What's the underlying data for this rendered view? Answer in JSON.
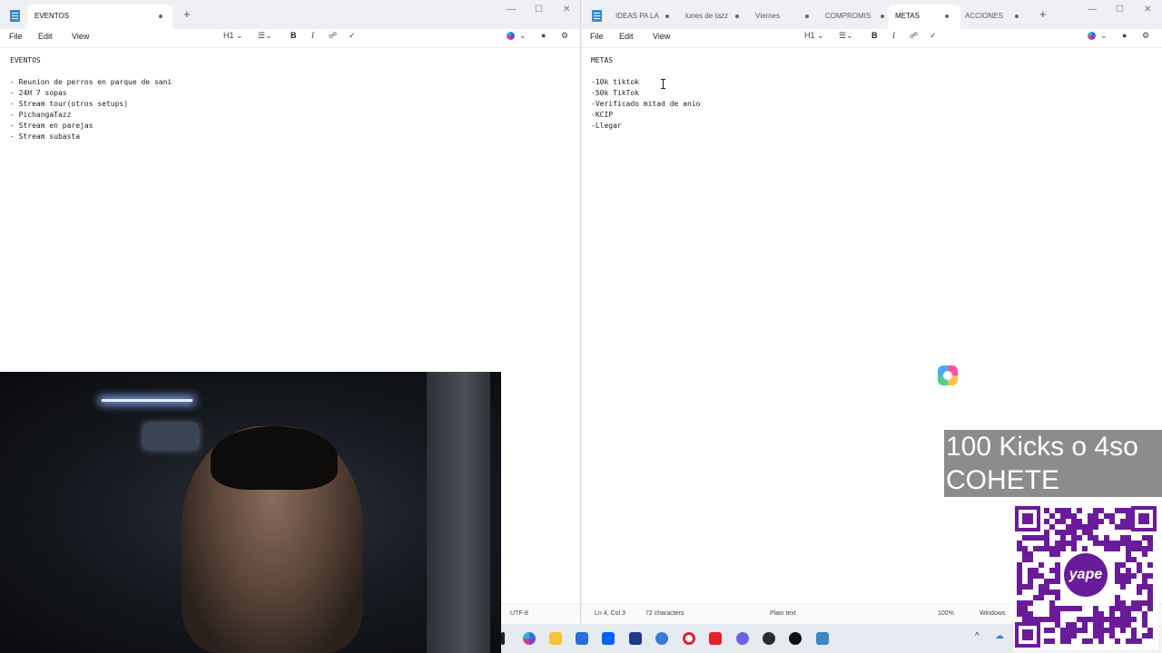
{
  "left_window": {
    "tabs": [
      {
        "label": "EVENTOS",
        "active": true
      }
    ],
    "menu": [
      "File",
      "Edit",
      "View"
    ],
    "heading_label": "H1",
    "format_icons": [
      "heading-icon",
      "list-icon",
      "bold-icon",
      "italic-icon",
      "link-icon",
      "clear-formatting-icon",
      "copilot-icon",
      "account-icon",
      "settings-icon"
    ],
    "bold_label": "B",
    "italic_label": "I",
    "content_lines": [
      "EVENTOS",
      "",
      "- Reunion de perros en parque de sani",
      "- 24H 7 sopas",
      "- Stream tour(otros setups)",
      "- PichangaTazz",
      "- Stream en parejas",
      "- Stream subasta"
    ],
    "status_encoding": "UTF-8"
  },
  "right_window": {
    "tabs": [
      {
        "label": "IDEAS PA LA",
        "active": false
      },
      {
        "label": "lunes de tazz",
        "active": false
      },
      {
        "label": "Viernes",
        "active": false
      },
      {
        "label": "COMPROMIS",
        "active": false
      },
      {
        "label": "METAS",
        "active": true
      },
      {
        "label": "ACCIONES",
        "active": false
      }
    ],
    "menu": [
      "File",
      "Edit",
      "View"
    ],
    "heading_label": "H1",
    "bold_label": "B",
    "italic_label": "I",
    "content_lines": [
      "METAS",
      "",
      "-10k tiktok",
      "-50k TikTok",
      "-Verificado mitad de anio",
      "-KCIP",
      "-Llegar"
    ],
    "status": {
      "position": "Ln 4, Col 3",
      "characters": "72 characters",
      "mode": "Plain text",
      "zoom": "100%",
      "line_ending": "Windows"
    }
  },
  "overlay": {
    "banner_line1": "100 Kicks o 4so",
    "banner_line2": "COHETE",
    "qr_brand": "yape",
    "accent_color": "#6a1b9a"
  },
  "taskbar": {
    "icons": [
      "terminal-icon",
      "copilot-icon",
      "file-explorer-icon",
      "store-icon",
      "dropbox-icon",
      "vscode-icon",
      "browser-icon",
      "opera-icon",
      "brave-icon",
      "discord-icon",
      "obs-icon",
      "game-icon",
      "notepad-icon"
    ],
    "tray_chevron": "^"
  }
}
